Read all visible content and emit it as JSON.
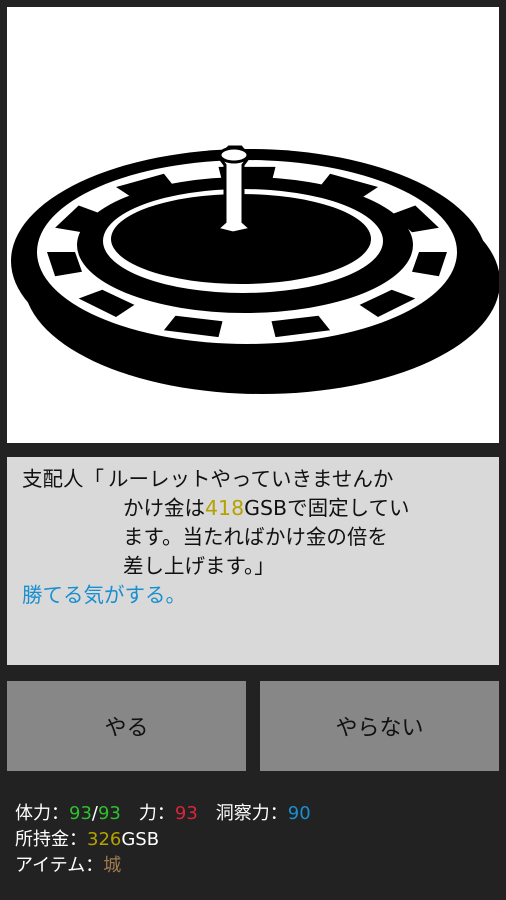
{
  "scene": {
    "icon": "roulette-wheel"
  },
  "dialog": {
    "speaker": "支配人「",
    "line1_text": "ルーレットやっていきませんか",
    "line2_prefix": "かけ金は",
    "bet_amount": "418",
    "line2_suffix": "GSBで固定してい",
    "line3": "ます。当たればかけ金の倍を",
    "line4": "差し上げます。」",
    "thought": "勝てる気がする。"
  },
  "buttons": {
    "yes": "やる",
    "no": "やらない"
  },
  "status": {
    "hp_label": "体力：",
    "hp_current": "93",
    "hp_sep": "/",
    "hp_max": "93",
    "power_label": "力：",
    "power_value": "93",
    "insight_label": "洞察力：",
    "insight_value": "90",
    "money_label": "所持金：",
    "money_value": "326",
    "money_unit": "GSB",
    "item_label": "アイテム：",
    "item_value": "城"
  },
  "colors": {
    "hp": "#2fbf2f",
    "power": "#d8253a",
    "insight": "#1a8fd0",
    "money": "#b5a100",
    "item": "#a07b4f"
  }
}
